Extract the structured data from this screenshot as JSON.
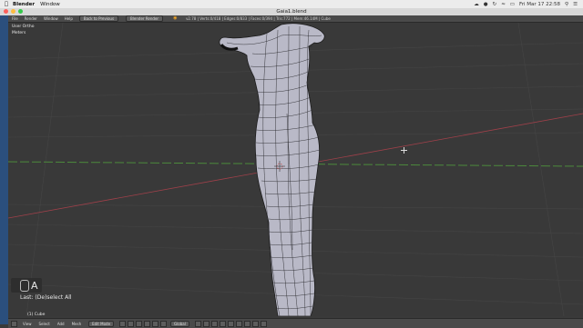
{
  "mac_menubar": {
    "app_name": "Blender",
    "menu_window": "Window",
    "clock": "Fri Mar 17  22:58"
  },
  "window": {
    "title": "Gaia1.blend"
  },
  "info_header": {
    "menus": [
      "File",
      "Render",
      "Window",
      "Help"
    ],
    "back_button": "Back to Previous",
    "render_engine": "Blender Render",
    "stats": "v2.78 | Verts:0/418 | Edges:0/833 | Faces:0/394 | Tris:772 | Mem:46.14M | Cube"
  },
  "viewport": {
    "view_name": "User Ortho",
    "units": "Meters",
    "key_indicator": "A",
    "last_operation": "Last: (De)select All",
    "object_name": "(1) Cube"
  },
  "view3d_header": {
    "menus": [
      "View",
      "Select",
      "Add",
      "Mesh"
    ],
    "mode": "Edit Mode",
    "orientation": "Global"
  },
  "colors": {
    "viewport_bg": "#393939",
    "mesh_fill": "#b9b9c7",
    "mesh_wire": "#1c1c1c",
    "x_axis": "#a0404a",
    "y_axis": "#4c8a3c",
    "accent": "#f5a623"
  }
}
